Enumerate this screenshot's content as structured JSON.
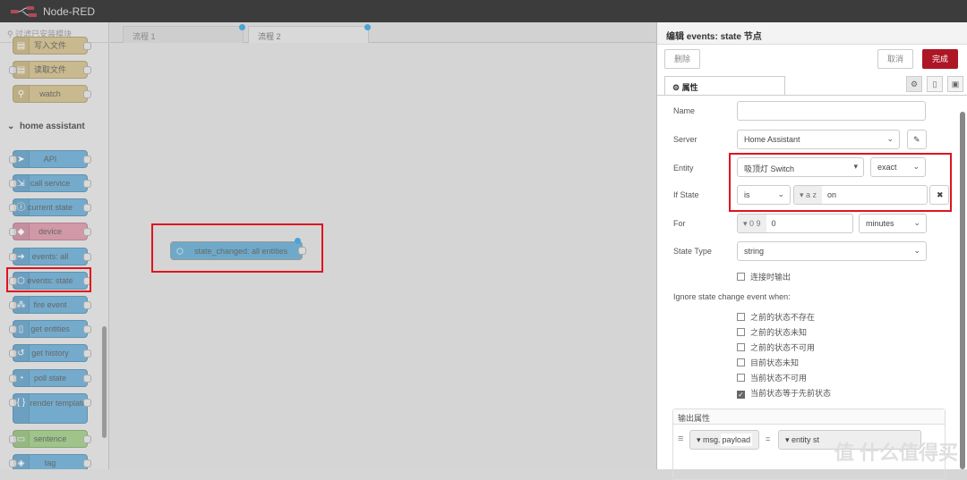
{
  "header": {
    "title": "Node-RED"
  },
  "palette": {
    "filter_placeholder": "过滤已安装模块",
    "category": "home assistant",
    "top_nodes": [
      {
        "label": "写入文件"
      },
      {
        "label": "读取文件"
      },
      {
        "label": "watch"
      }
    ],
    "nodes": [
      {
        "label": "API",
        "color": "blue"
      },
      {
        "label": "call service",
        "color": "blue"
      },
      {
        "label": "current state",
        "color": "blue"
      },
      {
        "label": "device",
        "color": "pink"
      },
      {
        "label": "events: all",
        "color": "blue"
      },
      {
        "label": "events: state",
        "color": "blue"
      },
      {
        "label": "fire event",
        "color": "blue"
      },
      {
        "label": "get entities",
        "color": "blue"
      },
      {
        "label": "get history",
        "color": "blue"
      },
      {
        "label": "poll state",
        "color": "blue"
      },
      {
        "label": "render template",
        "color": "blue"
      },
      {
        "label": "sentence",
        "color": "green"
      },
      {
        "label": "tag",
        "color": "blue"
      }
    ]
  },
  "tabs": [
    {
      "label": "流程 1"
    },
    {
      "label": "流程 2"
    }
  ],
  "canvas": {
    "node_label": "state_changed: all entities"
  },
  "editor": {
    "title": "编辑 events: state 节点",
    "delete": "删除",
    "cancel": "取消",
    "done": "完成",
    "tab": "属性",
    "name_label": "Name",
    "name_value": "",
    "server_label": "Server",
    "server_value": "Home Assistant",
    "entity_label": "Entity",
    "entity_value": "吸顶灯 Switch",
    "entity_match": "exact",
    "ifstate_label": "If State",
    "ifstate_op": "is",
    "ifstate_type": "a z",
    "ifstate_value": "on",
    "for_label": "For",
    "for_type": "0 9",
    "for_value": "0",
    "for_unit": "minutes",
    "statetype_label": "State Type",
    "statetype_value": "string",
    "output_on_connect": "连接时输出",
    "ignore_label": "Ignore state change event when:",
    "ignore_options": [
      {
        "label": "之前的状态不存在",
        "checked": false
      },
      {
        "label": "之前的状态未知",
        "checked": false
      },
      {
        "label": "之前的状态不可用",
        "checked": false
      },
      {
        "label": "目前状态未知",
        "checked": false
      },
      {
        "label": "当前状态不可用",
        "checked": false
      },
      {
        "label": "当前状态等于先前状态",
        "checked": true
      }
    ],
    "output_props_label": "输出属性",
    "output_row": {
      "prefix": "msg.",
      "property": "payload",
      "eq": "=",
      "value": "entity st"
    }
  },
  "watermark": "值 什么值得买"
}
